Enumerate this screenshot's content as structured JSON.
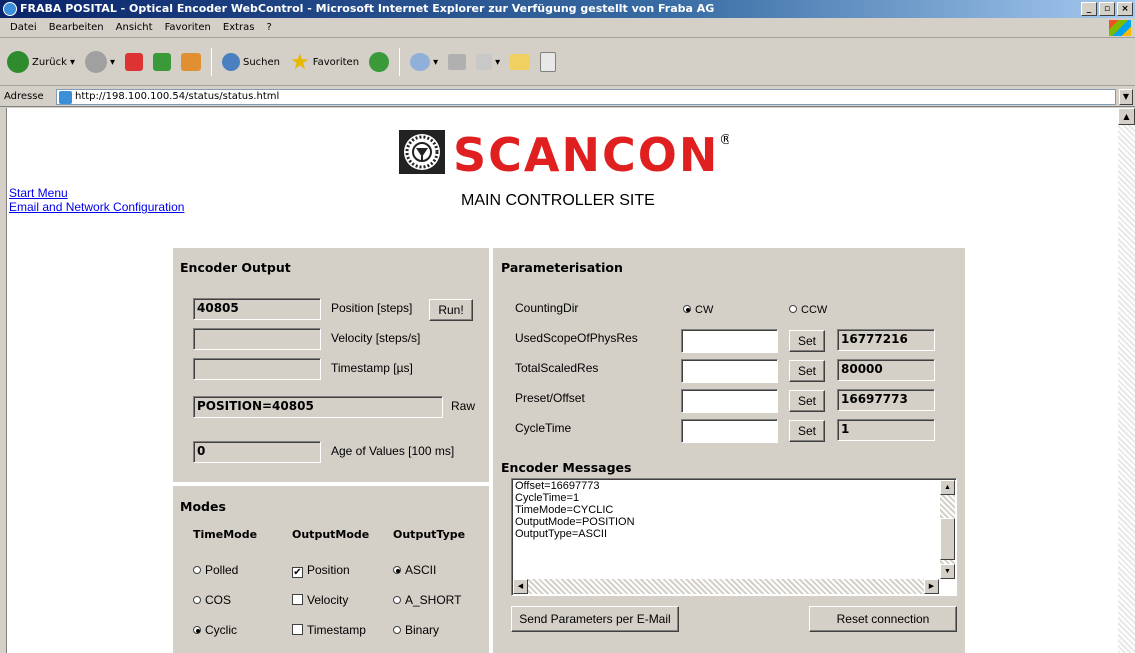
{
  "window": {
    "title": "FRABA POSITAL - Optical Encoder WebControl - Microsoft Internet Explorer zur Verfügung gestellt von Fraba AG",
    "buttons": [
      "_",
      "▫",
      "×"
    ]
  },
  "menu": [
    "Datei",
    "Bearbeiten",
    "Ansicht",
    "Favoriten",
    "Extras",
    "?"
  ],
  "toolbar": {
    "back_label": "Zurück",
    "search_label": "Suchen",
    "favorites_label": "Favoriten"
  },
  "address": {
    "label": "Adresse",
    "url": "http://198.100.100.54/status/status.html"
  },
  "links": {
    "start_menu": "Start Menu",
    "email_config": "Email and Network Configuration"
  },
  "logo": {
    "text": "SCANCON",
    "registered": "®"
  },
  "subtitle": "MAIN CONTROLLER SITE",
  "encoder_output": {
    "title": "Encoder Output",
    "position_value": "40805",
    "position_label": "Position [steps]",
    "run_button": "Run!",
    "velocity_value": "",
    "velocity_label": "Velocity [steps/s]",
    "timestamp_value": "",
    "timestamp_label": "Timestamp [µs]",
    "raw_value": "POSITION=40805",
    "raw_label": "Raw",
    "age_value": "0",
    "age_label": "Age of Values [100 ms]"
  },
  "modes": {
    "title": "Modes",
    "headers": [
      "TimeMode",
      "OutputMode",
      "OutputType"
    ],
    "time_mode": [
      {
        "label": "Polled",
        "checked": false
      },
      {
        "label": "COS",
        "checked": false
      },
      {
        "label": "Cyclic",
        "checked": true
      }
    ],
    "output_mode": [
      {
        "label": "Position",
        "checked": true
      },
      {
        "label": "Velocity",
        "checked": false
      },
      {
        "label": "Timestamp",
        "checked": false
      }
    ],
    "output_type": [
      {
        "label": "ASCII",
        "checked": true
      },
      {
        "label": "A_SHORT",
        "checked": false
      },
      {
        "label": "Binary",
        "checked": false
      }
    ]
  },
  "parameterisation": {
    "title": "Parameterisation",
    "counting_dir_label": "CountingDir",
    "cw_label": "CW",
    "ccw_label": "CCW",
    "cw_selected": true,
    "set_label": "Set",
    "rows": [
      {
        "label": "UsedScopeOfPhysRes",
        "value": "16777216"
      },
      {
        "label": "TotalScaledRes",
        "value": "80000"
      },
      {
        "label": "Preset/Offset",
        "value": "16697773"
      },
      {
        "label": "CycleTime",
        "value": "1"
      }
    ]
  },
  "messages": {
    "title": "Encoder Messages",
    "lines": [
      "Offset=16697773",
      "CycleTime=1",
      "TimeMode=CYCLIC",
      "OutputMode=POSITION",
      "OutputType=ASCII"
    ],
    "send_button": "Send Parameters per E-Mail",
    "reset_button": "Reset connection"
  }
}
